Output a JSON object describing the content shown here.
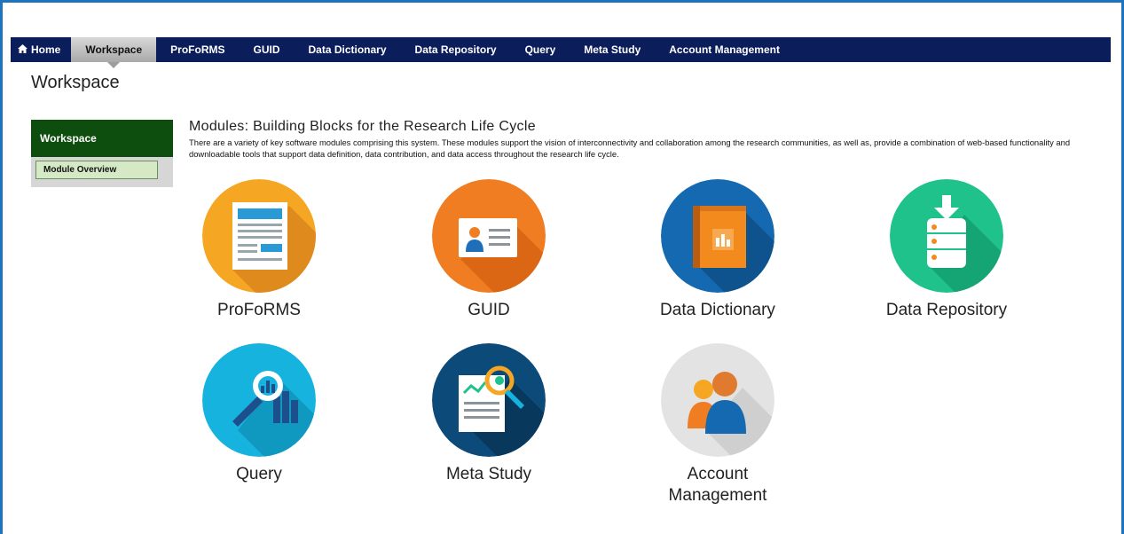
{
  "nav": {
    "home": "Home",
    "items": [
      "Workspace",
      "ProFoRMS",
      "GUID",
      "Data Dictionary",
      "Data Repository",
      "Query",
      "Meta Study",
      "Account Management"
    ]
  },
  "page": {
    "title": "Workspace"
  },
  "sidebar": {
    "header": "Workspace",
    "sub_item": "Module Overview"
  },
  "modules": {
    "heading": "Modules: Building Blocks for the Research Life Cycle",
    "description": "There are a variety of key software modules comprising this system. These modules support the vision of interconnectivity and collaboration among the research communities, as well as, provide a combination of web-based functionality and downloadable tools that support data definition, data contribution, and data access throughout the research life cycle.",
    "tiles": [
      {
        "label": "ProFoRMS",
        "icon": "form-document-icon",
        "color": "#f5a623"
      },
      {
        "label": "GUID",
        "icon": "id-card-icon",
        "color": "#f07d22"
      },
      {
        "label": "Data Dictionary",
        "icon": "book-chart-icon",
        "color": "#1569b0"
      },
      {
        "label": "Data Repository",
        "icon": "database-download-icon",
        "color": "#1fc28b"
      },
      {
        "label": "Query",
        "icon": "magnifier-chart-icon",
        "color": "#17b3df"
      },
      {
        "label": "Meta Study",
        "icon": "report-magnifier-icon",
        "color": "#0c4a7a"
      },
      {
        "label": "Account Management",
        "icon": "users-icon",
        "color": "#e3e3e3"
      }
    ]
  }
}
